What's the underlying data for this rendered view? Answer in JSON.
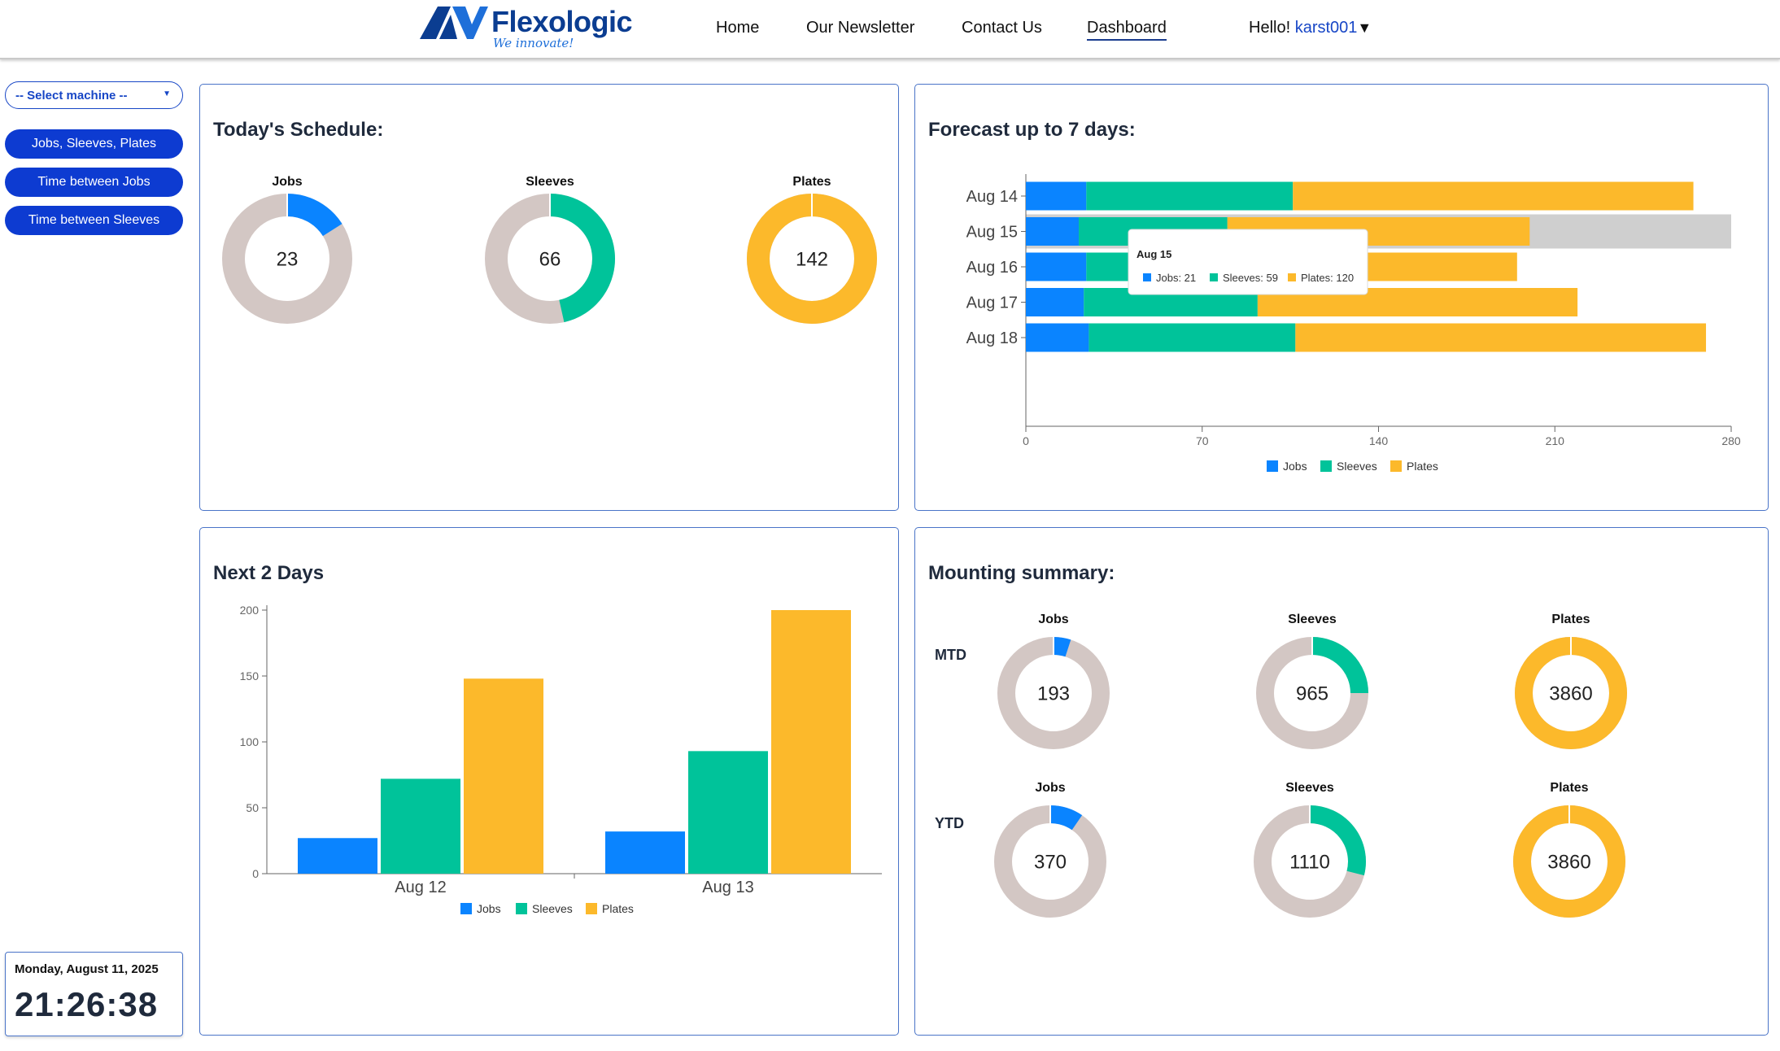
{
  "header": {
    "brand": "Flexologic",
    "tagline": "We innovate!",
    "nav": [
      "Home",
      "Our Newsletter",
      "Contact Us",
      "Dashboard"
    ],
    "active_nav": "Dashboard",
    "greeting": "Hello!",
    "username": "karst001"
  },
  "sidebar": {
    "select_placeholder": "-- Select machine --",
    "buttons": [
      "Jobs, Sleeves, Plates",
      "Time between Jobs",
      "Time between Sleeves"
    ]
  },
  "clock": {
    "date": "Monday, August 11, 2025",
    "time": "21:26:38"
  },
  "colors": {
    "jobs": "#0a84ff",
    "sleeves": "#00c39a",
    "plates": "#fcb92b",
    "remainder": "#d3c7c4",
    "accent": "#0d3bd1"
  },
  "today": {
    "title": "Today's Schedule:",
    "donuts": [
      {
        "label": "Jobs",
        "value": "23",
        "fraction": 0.16,
        "color_key": "jobs"
      },
      {
        "label": "Sleeves",
        "value": "66",
        "fraction": 0.465,
        "color_key": "sleeves"
      },
      {
        "label": "Plates",
        "value": "142",
        "fraction": 1.0,
        "color_key": "plates"
      }
    ]
  },
  "chart_data": [
    {
      "type": "bar",
      "orientation": "horizontal",
      "stacked": true,
      "title": "Forecast up to 7 days:",
      "categories": [
        "Aug 14",
        "Aug 15",
        "Aug 16",
        "Aug 17",
        "Aug 18"
      ],
      "series": [
        {
          "name": "Jobs",
          "values": [
            24,
            21,
            24,
            23,
            25
          ]
        },
        {
          "name": "Sleeves",
          "values": [
            82,
            59,
            83,
            69,
            82
          ]
        },
        {
          "name": "Plates",
          "values": [
            159,
            120,
            88,
            127,
            163
          ]
        }
      ],
      "xlim": [
        0,
        280
      ],
      "xticks": [
        0,
        70,
        140,
        210,
        280
      ],
      "legend": "bottom",
      "tooltip": {
        "title": "Aug 15",
        "items": [
          "Jobs: 21",
          "Sleeves: 59",
          "Plates: 120"
        ]
      }
    },
    {
      "type": "bar",
      "title": "Next 2 Days",
      "categories": [
        "Aug 12",
        "Aug 13"
      ],
      "series": [
        {
          "name": "Jobs",
          "values": [
            27,
            32
          ]
        },
        {
          "name": "Sleeves",
          "values": [
            72,
            93
          ]
        },
        {
          "name": "Plates",
          "values": [
            148,
            200
          ]
        }
      ],
      "ylim": [
        0,
        200
      ],
      "yticks": [
        0,
        50,
        100,
        150,
        200
      ],
      "legend": "bottom"
    }
  ],
  "mounting": {
    "title": "Mounting summary:",
    "rows": [
      {
        "label": "MTD",
        "donuts": [
          {
            "label": "Jobs",
            "value": "193",
            "fraction": 0.05,
            "color_key": "jobs"
          },
          {
            "label": "Sleeves",
            "value": "965",
            "fraction": 0.25,
            "color_key": "sleeves"
          },
          {
            "label": "Plates",
            "value": "3860",
            "fraction": 1.0,
            "color_key": "plates"
          }
        ]
      },
      {
        "label": "YTD",
        "donuts": [
          {
            "label": "Jobs",
            "value": "370",
            "fraction": 0.096,
            "color_key": "jobs"
          },
          {
            "label": "Sleeves",
            "value": "1110",
            "fraction": 0.29,
            "color_key": "sleeves"
          },
          {
            "label": "Plates",
            "value": "3860",
            "fraction": 1.0,
            "color_key": "plates"
          }
        ]
      }
    ]
  }
}
